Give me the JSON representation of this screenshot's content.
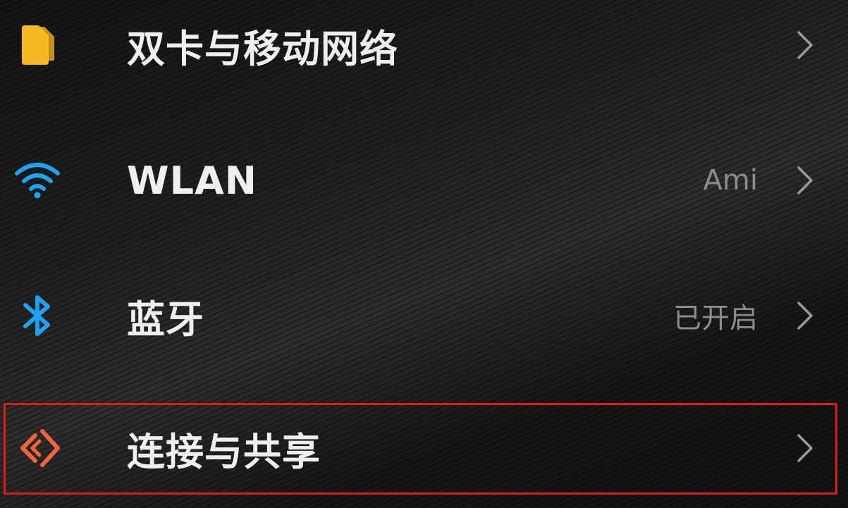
{
  "settings": {
    "items": [
      {
        "label": "双卡与移动网络",
        "status": "",
        "icon": "sim-card-icon"
      },
      {
        "label": "WLAN",
        "status": "Ami",
        "icon": "wifi-icon"
      },
      {
        "label": "蓝牙",
        "status": "已开启",
        "icon": "bluetooth-icon"
      },
      {
        "label": "连接与共享",
        "status": "",
        "icon": "connection-sharing-icon"
      }
    ],
    "highlighted_item": "连接与共享"
  },
  "colors": {
    "sim_icon": "#f5b921",
    "wifi_icon": "#1fa3f0",
    "bluetooth_icon": "#1fa3f0",
    "share_icon": "#f0643c",
    "highlight_border": "#d91c1c",
    "chevron": "#9a9a9a",
    "label_text": "#efefef",
    "status_text": "#8c8c8c"
  }
}
